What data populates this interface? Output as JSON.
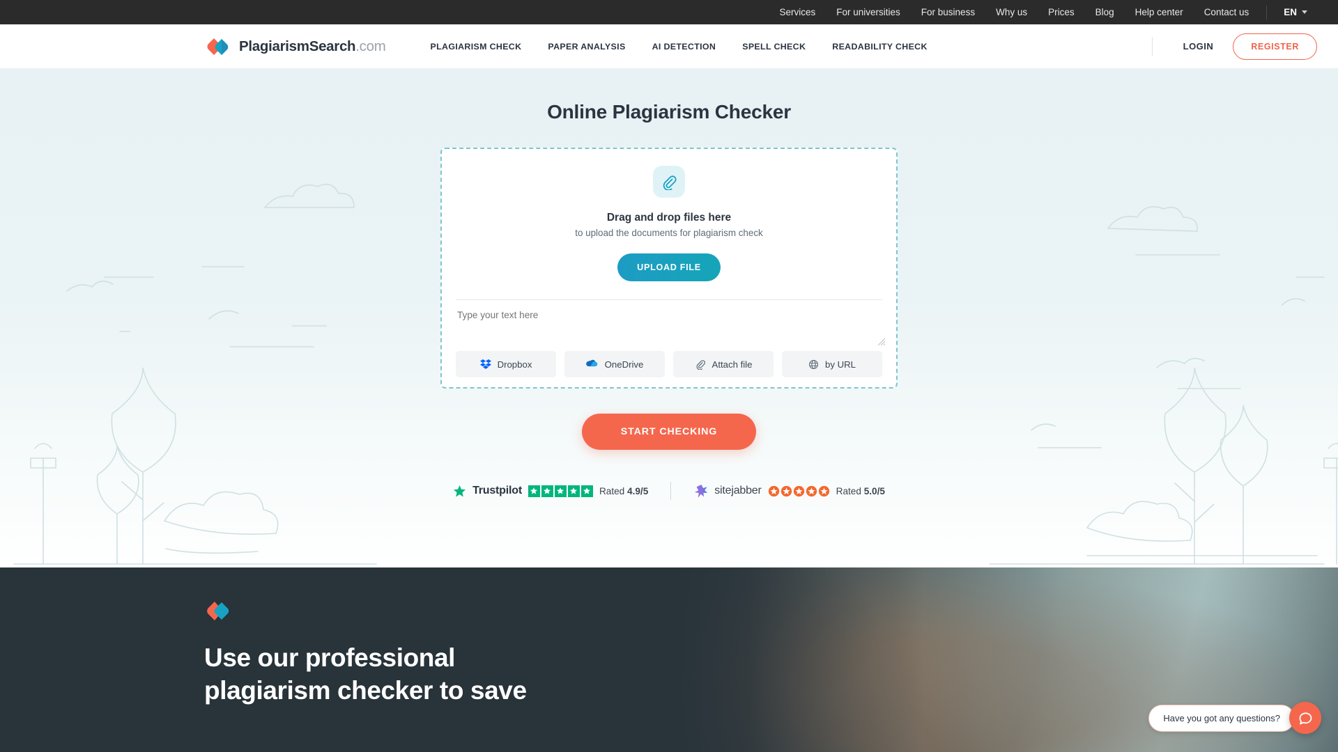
{
  "topbar": {
    "links": [
      "Services",
      "For universities",
      "For business",
      "Why us",
      "Prices",
      "Blog",
      "Help center",
      "Contact us"
    ],
    "language": "EN"
  },
  "header": {
    "logo_text": "PlagiarismSearch",
    "logo_suffix": ".com",
    "nav": [
      "PLAGIARISM CHECK",
      "PAPER ANALYSIS",
      "AI DETECTION",
      "SPELL CHECK",
      "READABILITY CHECK"
    ],
    "login_label": "LOGIN",
    "register_label": "REGISTER"
  },
  "hero": {
    "title": "Online Plagiarism Checker",
    "dropzone": {
      "icon": "paperclip-icon",
      "title": "Drag and drop files here",
      "subtitle": "to upload the documents for plagiarism check",
      "upload_label": "UPLOAD FILE",
      "textarea_placeholder": "Type your text here",
      "textarea_value": "",
      "sources": [
        {
          "label": "Dropbox",
          "icon": "dropbox-icon"
        },
        {
          "label": "OneDrive",
          "icon": "onedrive-icon"
        },
        {
          "label": "Attach file",
          "icon": "paperclip-icon"
        },
        {
          "label": "by URL",
          "icon": "globe-icon"
        }
      ]
    },
    "start_label": "START CHECKING",
    "ratings": [
      {
        "name": "Trustpilot",
        "rated_label": "Rated",
        "score": "4.9/5",
        "stars": 5,
        "star_color": "#00b67a"
      },
      {
        "name": "sitejabber",
        "rated_label": "Rated",
        "score": "5.0/5",
        "stars": 5,
        "star_color": "#f4682e"
      }
    ]
  },
  "dark_section": {
    "heading": "Use our professional plagiarism checker to save"
  },
  "chat": {
    "bubble_text": "Have you got any questions?",
    "fab_icon": "chat-icon"
  },
  "colors": {
    "accent_orange": "#f4674d",
    "accent_teal": "#16a5b8",
    "topbar_bg": "#2b2b2b",
    "dark_bg": "#28333a",
    "hero_bg": "#e8f2f4"
  }
}
